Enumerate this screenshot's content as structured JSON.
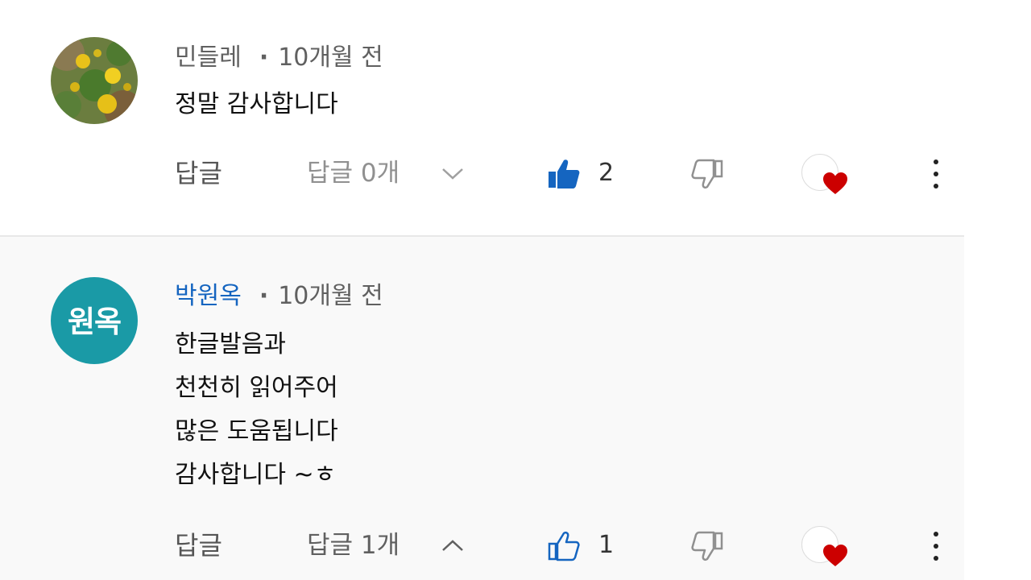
{
  "comments": [
    {
      "author": "민들레",
      "time": "10개월 전",
      "avatar_text": "",
      "lines": [
        "정말 감사합니다"
      ],
      "reply_label": "답글",
      "replies_label": "답글 0개",
      "like_count": "2",
      "liked": true,
      "replies_expanded": false
    },
    {
      "author": "박원옥",
      "time": "10개월 전",
      "avatar_text": "원옥",
      "lines": [
        "한글발음과",
        "천천히 읽어주어",
        "많은 도움됩니다",
        "감사합니다 ~ㅎ"
      ],
      "reply_label": "답글",
      "replies_label": "답글 1개",
      "like_count": "1",
      "liked": false,
      "replies_expanded": true
    }
  ],
  "icons": {
    "like": "thumbs-up-icon",
    "dislike": "thumbs-down-icon",
    "heart": "creator-heart-icon",
    "more": "more-vert-icon",
    "chevron_down": "chevron-down-icon",
    "chevron_up": "chevron-up-icon"
  },
  "colors": {
    "like_active": "#1565c0",
    "author_highlight": "#1565c0",
    "avatar_bg": "#1a9aa6",
    "heart": "#cc0000"
  }
}
